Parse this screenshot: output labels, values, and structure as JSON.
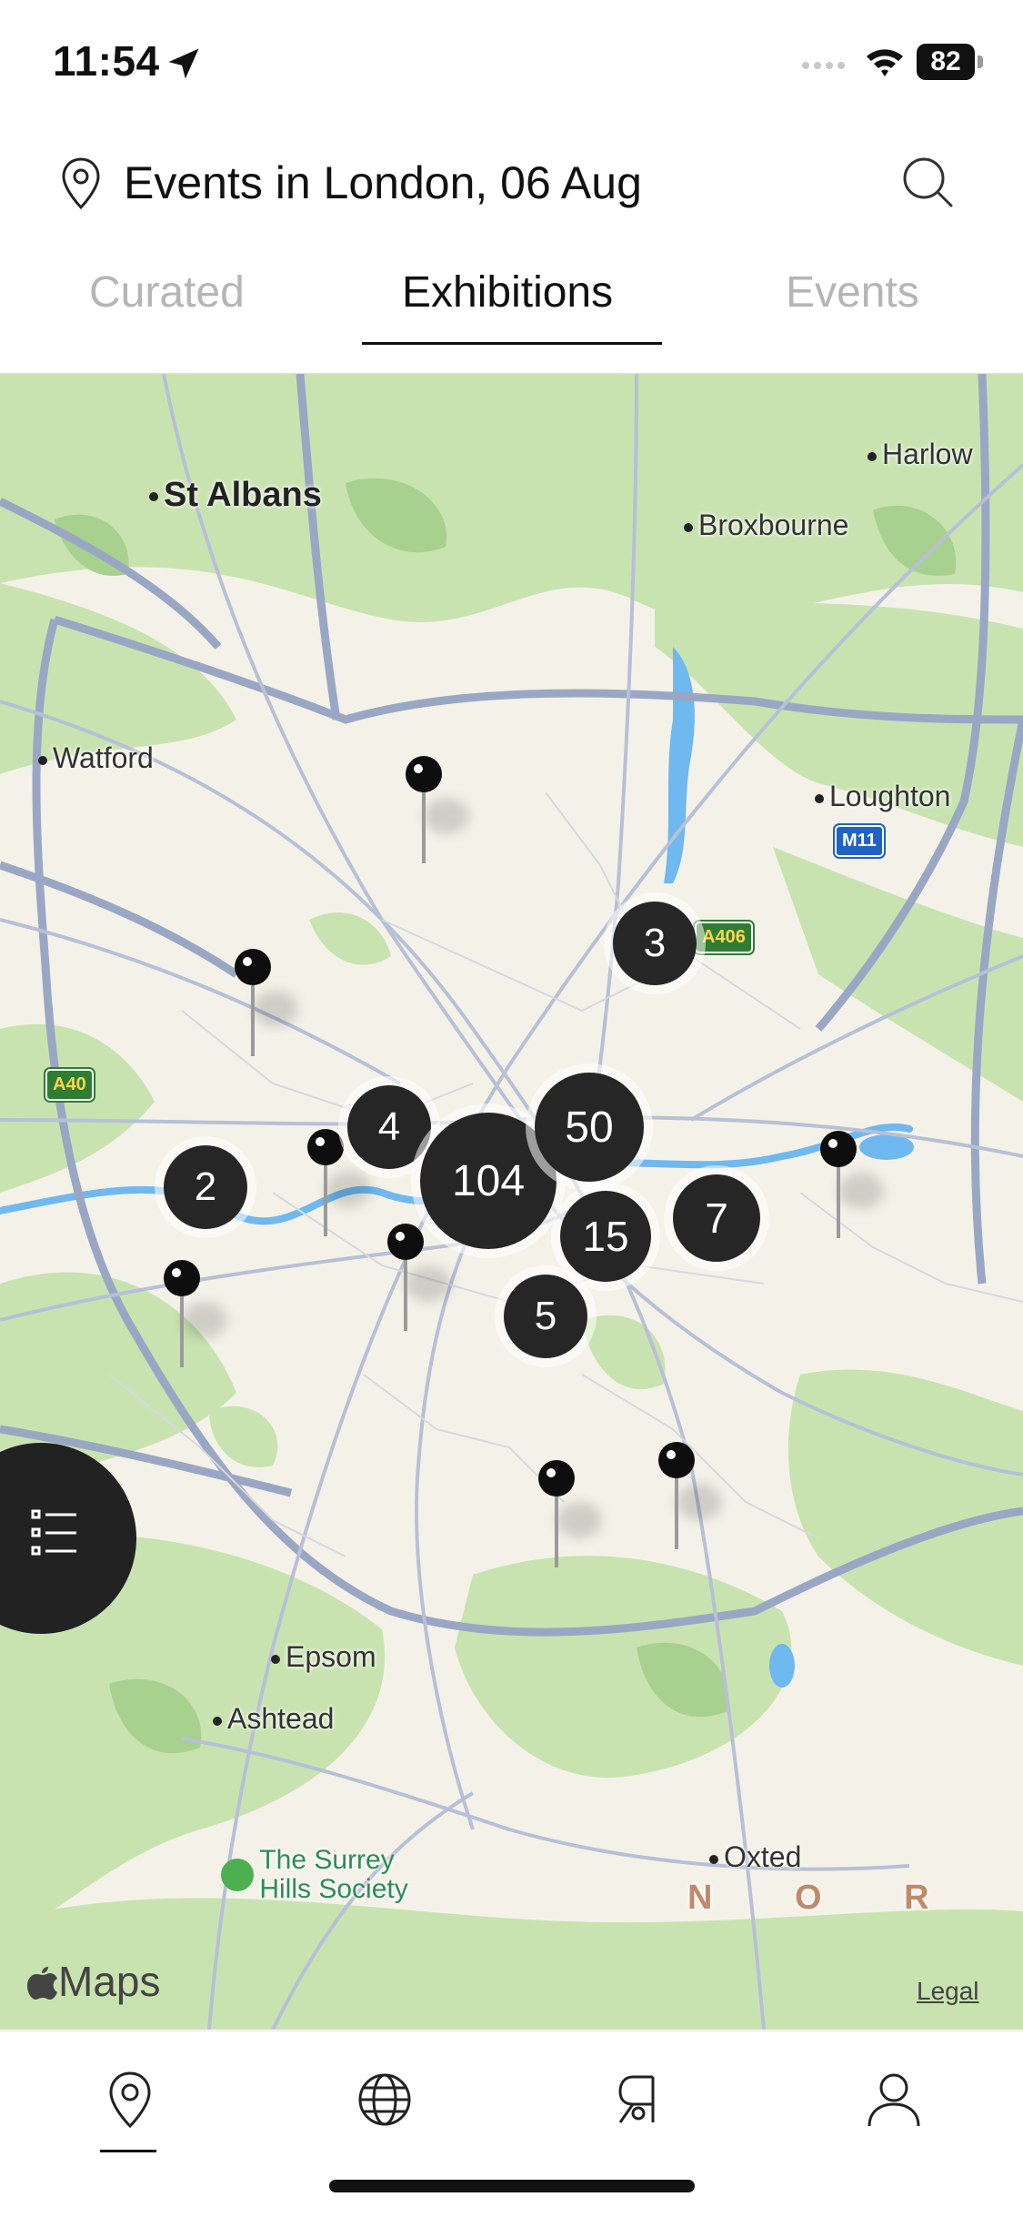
{
  "status": {
    "time": "11:54",
    "battery": "82"
  },
  "header": {
    "title": "Events in London, 06 Aug"
  },
  "tabs": [
    {
      "label": "Curated",
      "active": false
    },
    {
      "label": "Exhibitions",
      "active": true
    },
    {
      "label": "Events",
      "active": false
    }
  ],
  "map": {
    "places": {
      "st_albans": "St Albans",
      "harlow": "Harlow",
      "broxbourne": "Broxbourne",
      "watford": "Watford",
      "loughton": "Loughton",
      "epsom": "Epsom",
      "ashtead": "Ashtead",
      "surrey_hills": "The Surrey\nHills Society",
      "oxted": "Oxted",
      "north": "N O R"
    },
    "road_labels": {
      "m11": "M11",
      "a406": "A406",
      "a40": "A40"
    },
    "clusters": {
      "c104": "104",
      "c50": "50",
      "c15": "15",
      "c7": "7",
      "c5": "5",
      "c4": "4",
      "c3": "3",
      "c2": "2"
    },
    "attribution": "Maps",
    "legal": "Legal"
  },
  "bottom_nav": [
    {
      "icon": "map-pin-icon",
      "active": true
    },
    {
      "icon": "globe-icon",
      "active": false
    },
    {
      "icon": "r-logo-icon",
      "active": false
    },
    {
      "icon": "profile-icon",
      "active": false
    }
  ],
  "colors": {
    "accent": "#111111",
    "cluster": "#262626",
    "tab_inactive": "#b5b5b5",
    "map_land": "#f4f2e8",
    "map_green": "#c9e3b0",
    "map_road": "#9aa7c4"
  }
}
